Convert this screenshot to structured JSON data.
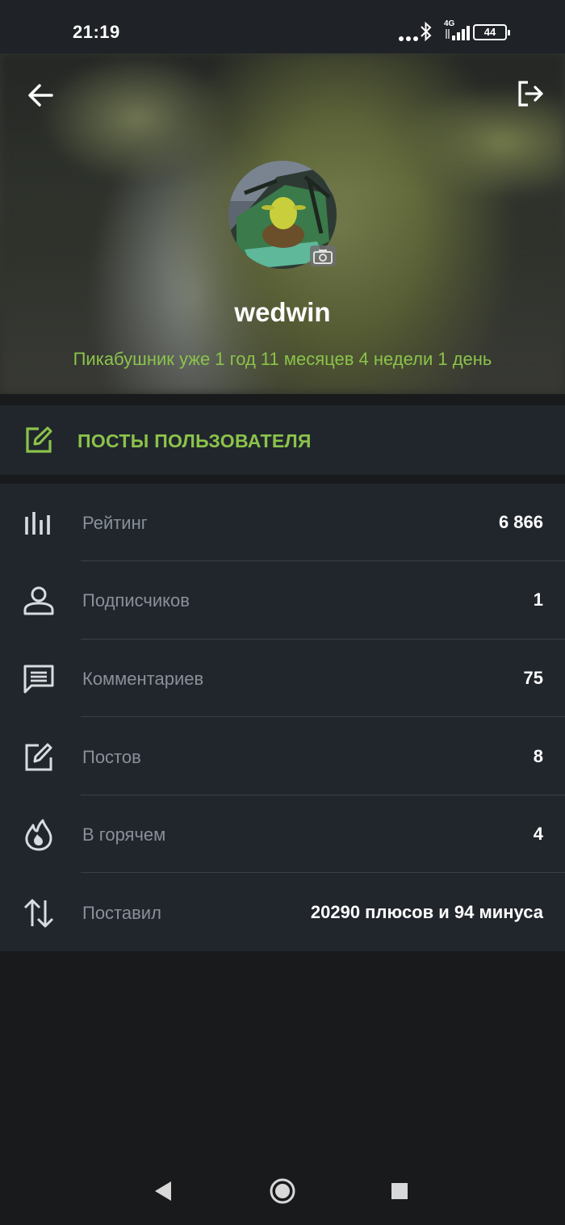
{
  "status_bar": {
    "time": "21:19",
    "network_type": "4G",
    "battery_level": "44",
    "icons": [
      "more-dots-icon",
      "bluetooth-icon",
      "signal-icon",
      "battery-icon"
    ]
  },
  "header": {
    "back_icon": "arrow-left-icon",
    "logout_icon": "logout-icon",
    "camera_icon": "camera-icon",
    "username": "wedwin",
    "member_since": "Пикабушник уже 1 год 11 месяцев 4 недели 1 день"
  },
  "posts_link": {
    "icon": "edit-icon",
    "label": "ПОСТЫ ПОЛЬЗОВАТЕЛЯ"
  },
  "stats": [
    {
      "icon": "bar-chart-icon",
      "label": "Рейтинг",
      "value": "6 866"
    },
    {
      "icon": "person-icon",
      "label": "Подписчиков",
      "value": "1"
    },
    {
      "icon": "comment-icon",
      "label": "Комментариев",
      "value": "75"
    },
    {
      "icon": "edit-icon",
      "label": "Постов",
      "value": "8"
    },
    {
      "icon": "fire-icon",
      "label": "В горячем",
      "value": "4"
    },
    {
      "icon": "sort-arrows-icon",
      "label": "Поставил",
      "value": "20290 плюсов и 94 минуса"
    }
  ],
  "colors": {
    "accent": "#8bc34a",
    "card": "#21262d",
    "background": "#191a1c",
    "label": "#8a9099"
  },
  "nav_bar": {
    "icons": [
      "nav-back-icon",
      "nav-home-icon",
      "nav-recents-icon"
    ]
  }
}
